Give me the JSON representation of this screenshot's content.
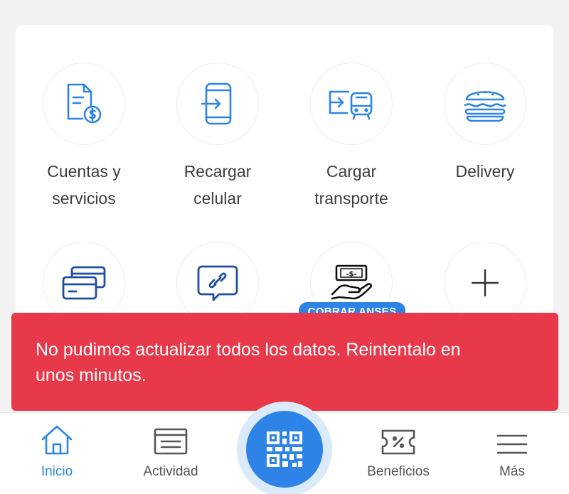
{
  "grid": {
    "items": [
      {
        "label_line1": "Cuentas y",
        "label_line2": "servicios",
        "icon": "bill-dollar-icon"
      },
      {
        "label_line1": "Recargar",
        "label_line2": "celular",
        "icon": "phone-recharge-icon"
      },
      {
        "label_line1": "Cargar",
        "label_line2": "transporte",
        "icon": "transport-card-icon"
      },
      {
        "label_line1": "Delivery",
        "label_line2": "",
        "icon": "burger-icon"
      },
      {
        "icon": "cards-icon"
      },
      {
        "icon": "link-chat-icon"
      },
      {
        "icon": "cash-hand-icon",
        "badge": "COBRAR ANSES"
      },
      {
        "icon": "plus-icon"
      }
    ]
  },
  "snackbar": {
    "line1": "No pudimos actualizar todos los datos. Reintentalo en",
    "line2": "unos minutos."
  },
  "bottom_nav": {
    "items": [
      {
        "label": "Inicio",
        "icon": "home-icon",
        "active": true
      },
      {
        "label": "Actividad",
        "icon": "activity-icon"
      },
      {
        "label": "",
        "icon": "qr-code-icon"
      },
      {
        "label": "Beneficios",
        "icon": "coupon-icon"
      },
      {
        "label": "Más",
        "icon": "menu-icon"
      }
    ]
  },
  "colors": {
    "accent": "#2d84e6",
    "error": "#e8394b",
    "text": "#3c3c3c"
  }
}
